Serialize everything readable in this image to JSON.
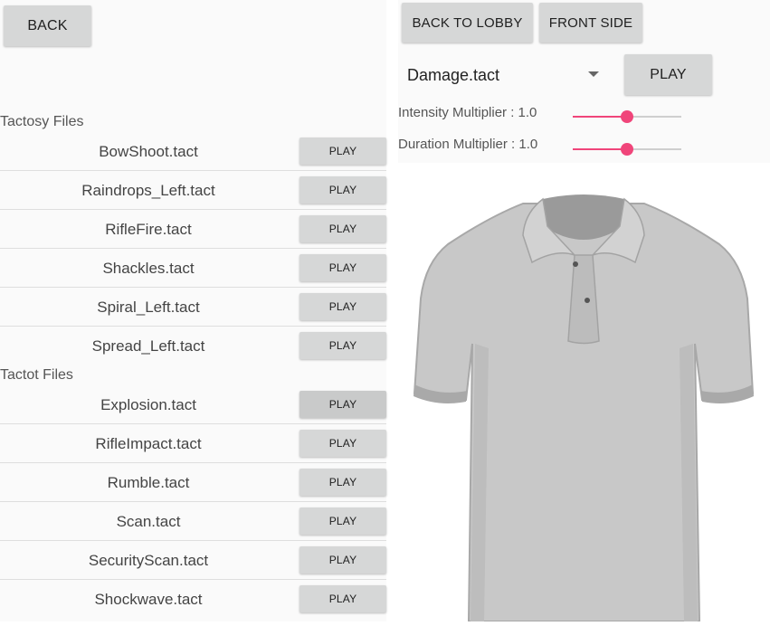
{
  "left": {
    "back_label": "BACK",
    "sections": [
      {
        "header": "Tactosy Files",
        "files": [
          "BowShoot.tact",
          "Raindrops_Left.tact",
          "RifleFire.tact",
          "Shackles.tact",
          "Spiral_Left.tact",
          "Spread_Left.tact"
        ]
      },
      {
        "header": "Tactot Files",
        "files": [
          "Explosion.tact",
          "RifleImpact.tact",
          "Rumble.tact",
          "Scan.tact",
          "SecurityScan.tact",
          "Shockwave.tact"
        ]
      }
    ],
    "play_label": "PLAY"
  },
  "right": {
    "back_to_lobby_label": "BACK TO LOBBY",
    "front_side_label": "FRONT SIDE",
    "dropdown": {
      "selected": "Damage.tact"
    },
    "play_label": "PLAY",
    "intensity": {
      "label": "Intensity Multiplier : 1.0",
      "value": 1.0,
      "max": 2.0
    },
    "duration": {
      "label": "Duration Multiplier : 1.0",
      "value": 1.0,
      "max": 2.0
    }
  },
  "colors": {
    "accent": "#f0457a",
    "button": "#d6d7d7",
    "shirt": "#c8c8c8"
  },
  "icons": [
    "dropdown-arrow-icon",
    "polo-shirt-front-icon"
  ]
}
